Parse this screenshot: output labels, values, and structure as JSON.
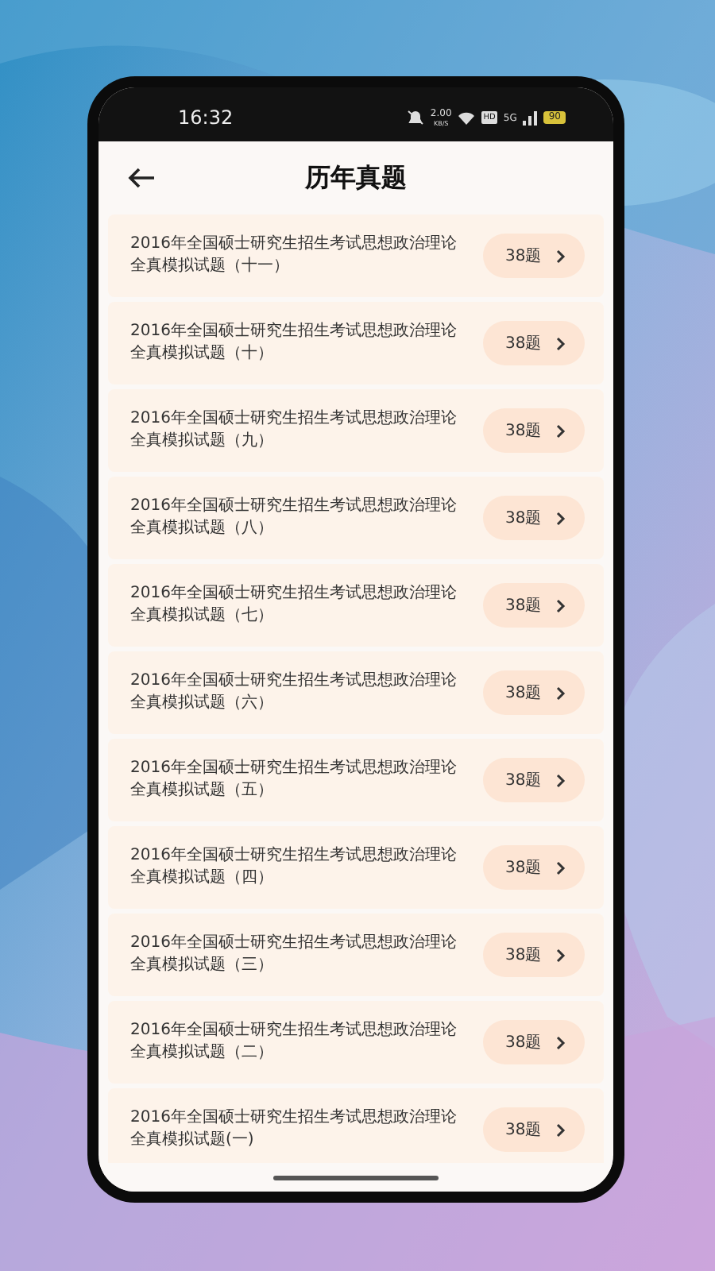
{
  "status_bar": {
    "time": "16:32",
    "speed_value": "2.00",
    "speed_unit": "KB/S",
    "hd": "HD",
    "network": "5G",
    "battery": "90"
  },
  "header": {
    "title": "历年真题"
  },
  "papers": [
    {
      "line1": "2016年全国硕士研究生招生考试思想政治理论",
      "line2": "全真模拟试题（十一）",
      "count": "38题"
    },
    {
      "line1": "2016年全国硕士研究生招生考试思想政治理论",
      "line2": "全真模拟试题（十）",
      "count": "38题"
    },
    {
      "line1": "2016年全国硕士研究生招生考试思想政治理论",
      "line2": "全真模拟试题（九）",
      "count": "38题"
    },
    {
      "line1": "2016年全国硕士研究生招生考试思想政治理论",
      "line2": "全真模拟试题（八）",
      "count": "38题"
    },
    {
      "line1": "2016年全国硕士研究生招生考试思想政治理论",
      "line2": "全真模拟试题（七）",
      "count": "38题"
    },
    {
      "line1": "2016年全国硕士研究生招生考试思想政治理论",
      "line2": "全真模拟试题（六）",
      "count": "38题"
    },
    {
      "line1": "2016年全国硕士研究生招生考试思想政治理论",
      "line2": "全真模拟试题（五）",
      "count": "38题"
    },
    {
      "line1": "2016年全国硕士研究生招生考试思想政治理论",
      "line2": "全真模拟试题（四）",
      "count": "38题"
    },
    {
      "line1": "2016年全国硕士研究生招生考试思想政治理论",
      "line2": "全真模拟试题（三）",
      "count": "38题"
    },
    {
      "line1": "2016年全国硕士研究生招生考试思想政治理论",
      "line2": "全真模拟试题（二）",
      "count": "38题"
    },
    {
      "line1": "2016年全国硕士研究生招生考试思想政治理论",
      "line2": "全真模拟试题(一)",
      "count": "38题"
    }
  ]
}
